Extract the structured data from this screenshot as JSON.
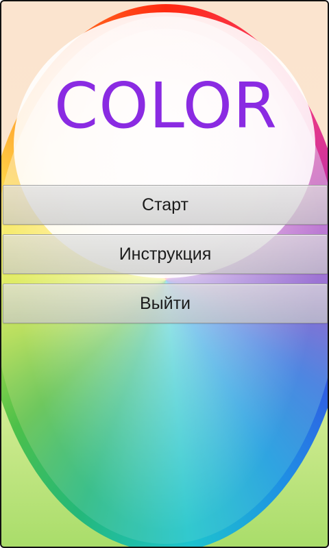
{
  "app": {
    "title": "COLOR"
  },
  "menu": {
    "start_label": "Старт",
    "instructions_label": "Инструкция",
    "exit_label": "Выйти"
  },
  "colors": {
    "title": "#8a2be2",
    "button_text": "#1b1b1b"
  },
  "icons": {
    "background": "color-wheel"
  }
}
